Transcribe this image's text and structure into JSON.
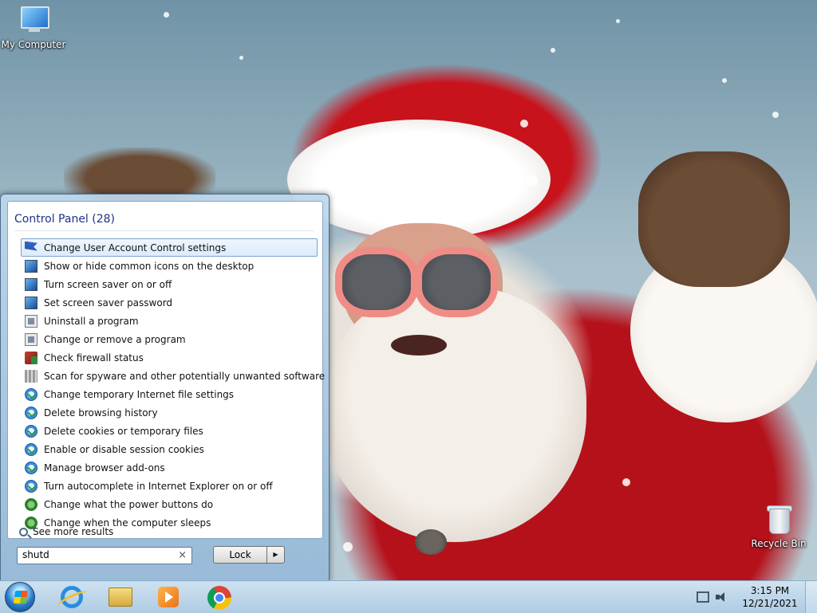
{
  "desktop": {
    "icons": [
      {
        "label": "My Computer",
        "icon": "computer-icon"
      },
      {
        "label": "Recycle Bin",
        "icon": "recycle-bin-icon"
      }
    ]
  },
  "start_menu": {
    "results_header": "Control Panel (28)",
    "results": [
      {
        "label": "Change User Account Control settings",
        "icon": "uac-flag-icon",
        "selected": true
      },
      {
        "label": "Show or hide common icons on the desktop",
        "icon": "display-icon"
      },
      {
        "label": "Turn screen saver on or off",
        "icon": "display-icon"
      },
      {
        "label": "Set screen saver password",
        "icon": "display-icon"
      },
      {
        "label": "Uninstall a program",
        "icon": "programs-icon"
      },
      {
        "label": "Change or remove a program",
        "icon": "programs-icon"
      },
      {
        "label": "Check firewall status",
        "icon": "firewall-icon"
      },
      {
        "label": "Scan for spyware and other potentially unwanted software",
        "icon": "defender-icon"
      },
      {
        "label": "Change temporary Internet file settings",
        "icon": "internet-options-icon"
      },
      {
        "label": "Delete browsing history",
        "icon": "internet-options-icon"
      },
      {
        "label": "Delete cookies or temporary files",
        "icon": "internet-options-icon"
      },
      {
        "label": "Enable or disable session cookies",
        "icon": "internet-options-icon"
      },
      {
        "label": "Manage browser add-ons",
        "icon": "internet-options-icon"
      },
      {
        "label": "Turn autocomplete in Internet Explorer on or off",
        "icon": "internet-options-icon"
      },
      {
        "label": "Change what the power buttons do",
        "icon": "power-options-icon"
      },
      {
        "label": "Change when the computer sleeps",
        "icon": "power-options-icon"
      }
    ],
    "see_more": "See more results",
    "search_value": "shutd",
    "lock_label": "Lock",
    "lock_arrow": "▶"
  },
  "taskbar": {
    "pinned": [
      "start-orb",
      "internet-explorer-icon",
      "windows-explorer-icon",
      "media-player-icon",
      "chrome-icon"
    ],
    "clock_time": "3:15 PM",
    "clock_date": "12/21/2021"
  },
  "colors": {
    "header_text": "#1e3287",
    "selection_border": "#7da2ce",
    "taskbar": "#aac8e1"
  }
}
